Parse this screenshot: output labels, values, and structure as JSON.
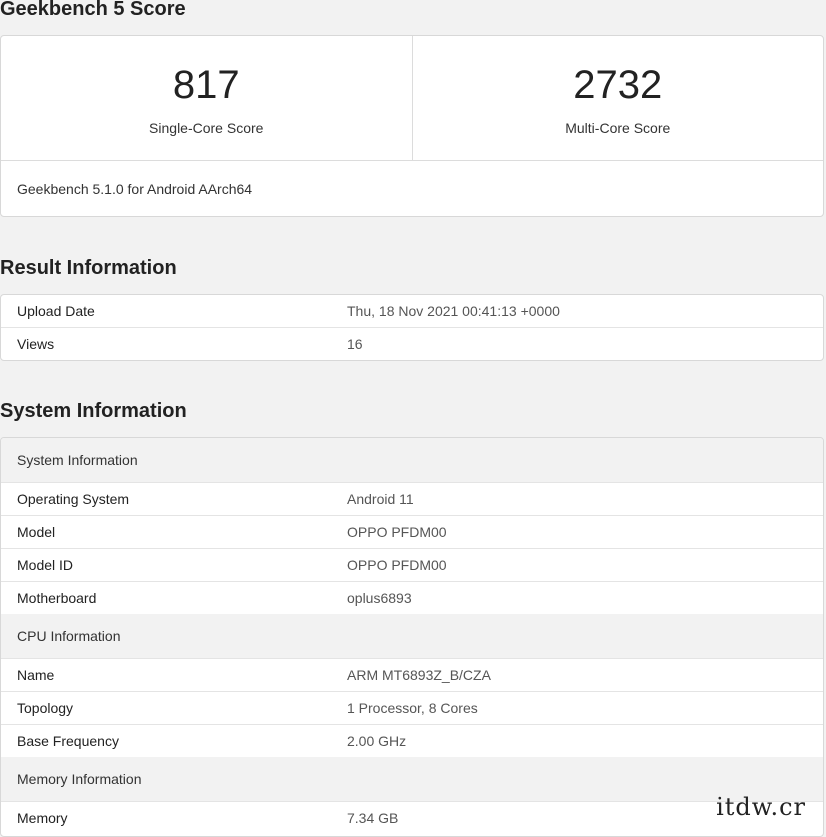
{
  "score_section": {
    "heading": "Geekbench 5 Score",
    "single_core": {
      "value": "817",
      "label": "Single-Core Score"
    },
    "multi_core": {
      "value": "2732",
      "label": "Multi-Core Score"
    },
    "version": "Geekbench 5.1.0 for Android AArch64"
  },
  "result_section": {
    "heading": "Result Information",
    "rows": [
      {
        "key": "Upload Date",
        "value": "Thu, 18 Nov 2021 00:41:13 +0000"
      },
      {
        "key": "Views",
        "value": "16"
      }
    ]
  },
  "system_section": {
    "heading": "System Information",
    "groups": [
      {
        "title": "System Information",
        "rows": [
          {
            "key": "Operating System",
            "value": "Android 11"
          },
          {
            "key": "Model",
            "value": "OPPO PFDM00"
          },
          {
            "key": "Model ID",
            "value": "OPPO PFDM00"
          },
          {
            "key": "Motherboard",
            "value": "oplus6893"
          }
        ]
      },
      {
        "title": "CPU Information",
        "rows": [
          {
            "key": "Name",
            "value": "ARM MT6893Z_B/CZA"
          },
          {
            "key": "Topology",
            "value": "1 Processor, 8 Cores"
          },
          {
            "key": "Base Frequency",
            "value": "2.00 GHz"
          }
        ]
      },
      {
        "title": "Memory Information",
        "rows": [
          {
            "key": "Memory",
            "value": "7.34 GB"
          }
        ]
      }
    ]
  },
  "watermark": "itdw.cr"
}
